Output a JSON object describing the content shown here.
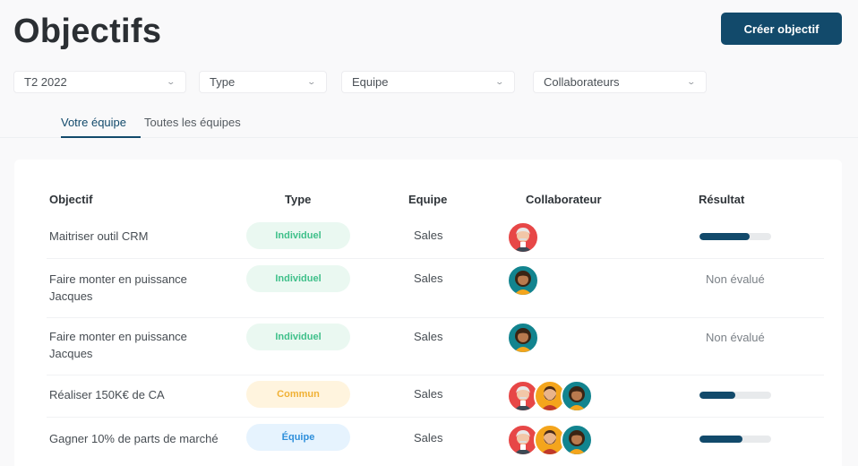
{
  "header": {
    "title": "Objectifs",
    "create_label": "Créer objectif"
  },
  "filters": [
    {
      "label": "T2 2022",
      "icon": "chevron-down-icon"
    },
    {
      "label": "Type",
      "icon": "chevron-down-icon"
    },
    {
      "label": "Equipe",
      "icon": "chevron-down-icon"
    },
    {
      "label": "Collaborateurs",
      "icon": "chevron-down-icon"
    }
  ],
  "tabs": [
    {
      "label": "Votre équipe",
      "active": true
    },
    {
      "label": "Toutes les équipes",
      "active": false
    }
  ],
  "table": {
    "headers": {
      "objectif": "Objectif",
      "type": "Type",
      "equipe": "Equipe",
      "collaborateur": "Collaborateur",
      "resultat": "Résultat"
    },
    "rows": [
      {
        "objectif": "Maitriser outil CRM",
        "type": "Individuel",
        "type_style": "individuel",
        "equipe": "Sales",
        "avatars": [
          "avatar-old-man"
        ],
        "progress": 0.7,
        "result_text": ""
      },
      {
        "objectif": "Faire monter en puissance Jacques",
        "type": "Individuel",
        "type_style": "individuel",
        "equipe": "Sales",
        "avatars": [
          "avatar-woman"
        ],
        "progress": null,
        "result_text": "Non évalué"
      },
      {
        "objectif": "Faire monter en puissance Jacques",
        "type": "Individuel",
        "type_style": "individuel",
        "equipe": "Sales",
        "avatars": [
          "avatar-woman"
        ],
        "progress": null,
        "result_text": "Non évalué"
      },
      {
        "objectif": "Réaliser 150K€ de CA",
        "type": "Commun",
        "type_style": "commun",
        "equipe": "Sales",
        "avatars": [
          "avatar-old-man",
          "avatar-bearded-man",
          "avatar-woman"
        ],
        "progress": 0.5,
        "result_text": ""
      },
      {
        "objectif": "Gagner 10% de parts de marché",
        "type": "Équipe",
        "type_style": "equipe",
        "equipe": "Sales",
        "avatars": [
          "avatar-old-man",
          "avatar-bearded-man",
          "avatar-woman"
        ],
        "progress": 0.6,
        "result_text": ""
      }
    ]
  },
  "colors": {
    "primary": "#124a6b",
    "individuel": "#3fc08a",
    "commun": "#f0b135",
    "equipe": "#2f8fdb"
  }
}
